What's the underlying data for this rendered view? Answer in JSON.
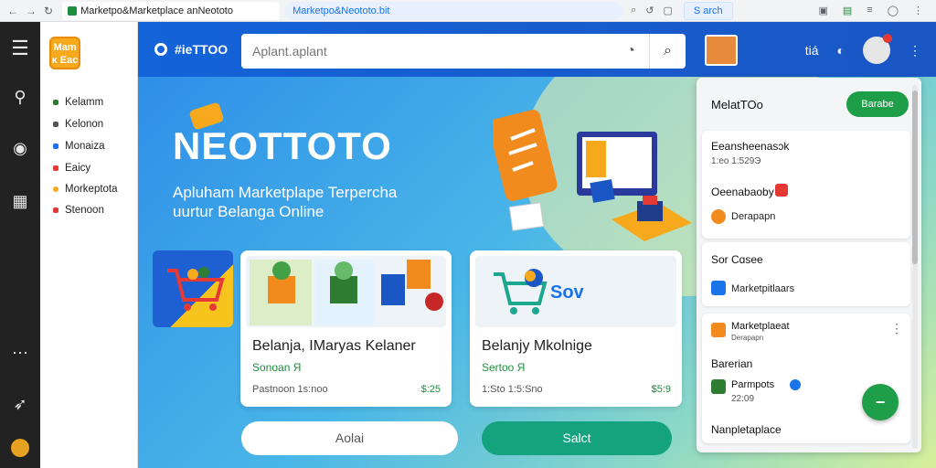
{
  "browser": {
    "tab_title": "Marketpo&Marketplace anNeototo",
    "url": "Marketpo&Neototo.bit",
    "find_label": "S arch"
  },
  "sidebar": {
    "logo_text": "Mam ᴋ Eac",
    "items": [
      {
        "label": "Kelamm",
        "color": "#2e7d32"
      },
      {
        "label": "Kelonon",
        "color": "#555555"
      },
      {
        "label": "Monaiza",
        "color": "#1a73e8"
      },
      {
        "label": "Eaicy",
        "color": "#e53935"
      },
      {
        "label": "Morkeptota",
        "color": "#f7a91e"
      },
      {
        "label": "Stenoon",
        "color": "#e53935"
      }
    ]
  },
  "header": {
    "brand": "#ieTTOO",
    "search_placeholder": "Aplant.aplant",
    "icon_label": "tiá"
  },
  "hero": {
    "title": "NEOTTOTO",
    "subtitle_line1": "Apluham Marketplape Terpercha",
    "subtitle_line2": "uurtur Belanga Online"
  },
  "cards": [
    {
      "title": "Belanja, IMaryas Kelaner",
      "price": "Sonoan Я",
      "meta": "Pastnoon 1s:noo",
      "amount": "$:25"
    },
    {
      "title": "Belanjy Mkolnige",
      "price": "Sertoo Я",
      "meta": "1:Sto 1:5:Sno",
      "amount": "$5:9",
      "thumb_text": "Sov"
    }
  ],
  "buttons": {
    "left": "Aolai",
    "right": "Salct"
  },
  "panel": {
    "title": "MelatTOo",
    "action": "Barabe",
    "sections": [
      {
        "title": "Eeansheenasɔk",
        "sub": "1:eo 1:529Э"
      },
      {
        "title": "Oeenabaoby",
        "sub": "Derapapn"
      },
      {
        "title": "Sor Cɑsee",
        "sub": "Marketpitlaars"
      },
      {
        "title": "Marketplaeat",
        "sub": "Derapapn"
      },
      {
        "title": "Barerian",
        "sub": "Parmpots"
      },
      {
        "title": "Nanpletaplace",
        "sub": "22:09"
      }
    ]
  },
  "colors": {
    "header_blue": "#1463d9",
    "accent_green": "#1e9e48",
    "teal_button": "#15a37f",
    "logo_orange": "#f7a91e"
  }
}
